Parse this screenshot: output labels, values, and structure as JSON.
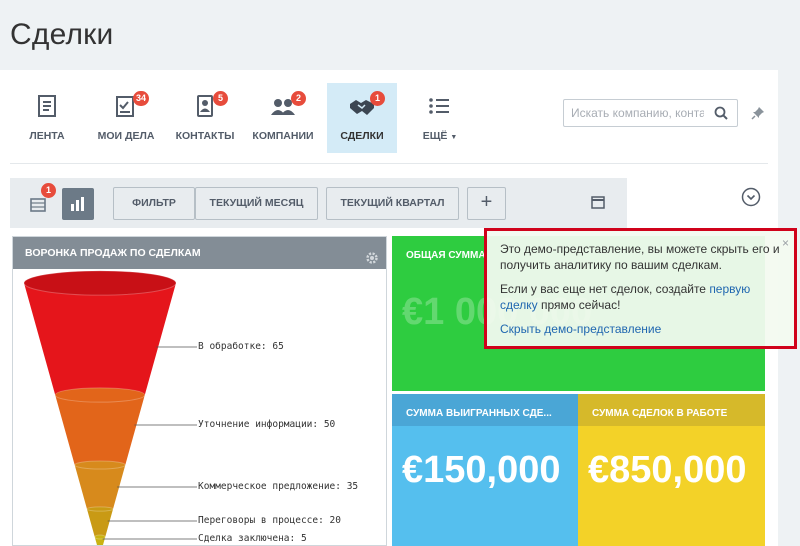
{
  "page": {
    "title": "Сделки"
  },
  "toolbar": {
    "items": [
      {
        "label": "ЛЕНТА",
        "icon": "news-feed-icon",
        "badge": ""
      },
      {
        "label": "МОИ ДЕЛА",
        "icon": "tasks-checklist-icon",
        "badge": "34"
      },
      {
        "label": "КОНТАКТЫ",
        "icon": "contacts-card-icon",
        "badge": "5"
      },
      {
        "label": "КОМПАНИИ",
        "icon": "companies-people-icon",
        "badge": "2"
      },
      {
        "label": "СДЕЛКИ",
        "icon": "handshake-icon",
        "badge": "1"
      },
      {
        "label": "ЕЩЁ",
        "icon": "list-icon",
        "badge": ""
      }
    ],
    "search_placeholder": "Искать компанию, конта"
  },
  "filter_bar": {
    "list_badge": "1",
    "buttons": [
      "ФИЛЬТР",
      "ТЕКУЩИЙ МЕСЯЦ",
      "ТЕКУЩИЙ КВАРТАЛ",
      "+"
    ]
  },
  "funnel": {
    "title": "ВОРОНКА ПРОДАЖ ПО СДЕЛКАМ",
    "stages": [
      {
        "label": "В обработке: 65",
        "value": 65,
        "color": "#e5151b"
      },
      {
        "label": "Уточнение информации: 50",
        "value": 50,
        "color": "#e2651a"
      },
      {
        "label": "Коммерческое предложение: 35",
        "value": 35,
        "color": "#d78a1c"
      },
      {
        "label": "Переговоры в процессе: 20",
        "value": 20,
        "color": "#c99a14"
      },
      {
        "label": "Сделка заключена: 5",
        "value": 5,
        "color": "#c9b312"
      }
    ]
  },
  "tiles": {
    "total": {
      "title": "ОБЩАЯ СУММА",
      "value": "€1 000 000"
    },
    "won": {
      "title": "СУММА ВЫИГРАННЫХ СДЕ...",
      "value": "€150,000"
    },
    "in_progress": {
      "title": "СУММА СДЕЛОК В РАБОТЕ",
      "value": "€850,000"
    }
  },
  "demo_popup": {
    "text1": "Это демо-представление, вы можете скрыть его и получить аналитику по вашим сделкам.",
    "text2_prefix": "Если у вас еще нет сделок, создайте ",
    "text2_link": "первую сделку",
    "text2_suffix": " прямо сейчас!",
    "hide_link": "Скрыть демо-представление",
    "close": "×"
  }
}
